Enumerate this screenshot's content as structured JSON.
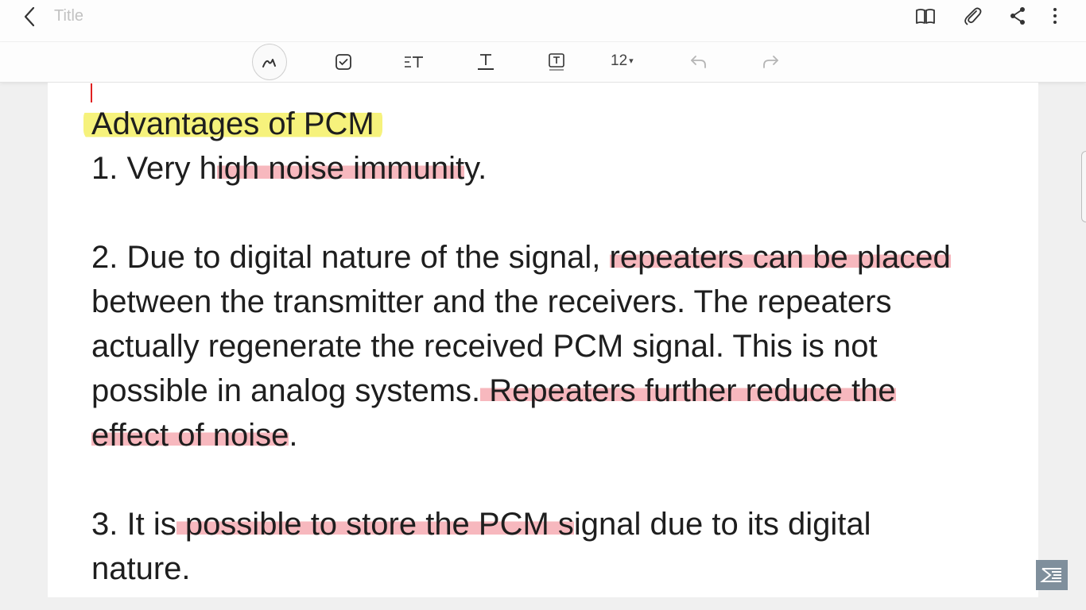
{
  "header": {
    "title": "Title",
    "icons": [
      "back-arrow-icon",
      "book-icon",
      "paperclip-icon",
      "share-icon",
      "more-vert-icon"
    ]
  },
  "toolbar": {
    "tools": [
      "pen-icon",
      "checkbox-icon",
      "text-style-icon",
      "text-underline-icon",
      "text-box-icon",
      "undo-icon",
      "redo-icon"
    ],
    "font_size": "12",
    "font_size_caret": "▾"
  },
  "note": {
    "heading": "Advantages of PCM",
    "p1": {
      "a": "1. Very h",
      "b": "igh noise immunit",
      "c": "y."
    },
    "p2": {
      "l1a": "2. Due to digital nature of the signal, ",
      "l1b": "repeaters can be placed",
      "l2": "between the transmitter and the receivers. The repeaters",
      "l3": "actually regenerate the received PCM signal. This is not",
      "l4a": "possible in analog systems.",
      "l4b": " Repeaters further reduce the ",
      "l5a": "effect of noise",
      "l5b": "."
    },
    "p3": {
      "l1a": "3. It is",
      "l1b": " possible to store the PCM s",
      "l1c": "ignal due to its digital",
      "l2": "nature."
    }
  },
  "colors": {
    "highlight_yellow": "#f6f27c",
    "highlight_red": "#f7b8be",
    "cursor": "#e02020",
    "page_bg": "#ffffff"
  }
}
